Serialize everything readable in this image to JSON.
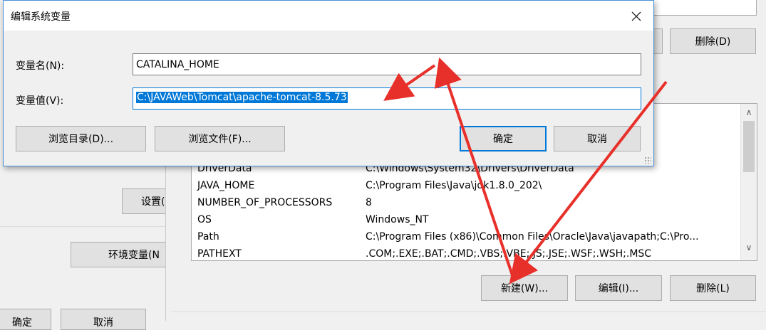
{
  "background_window": {
    "buttons": {
      "settings_partial": "设置(",
      "env_vars_partial": "环境变量(N",
      "ok_partial": "确定",
      "cancel_partial": "取消"
    }
  },
  "env_window": {
    "user_delete_button": "删除(D)",
    "system_vars": {
      "rows": [
        {
          "name": "DriverData",
          "value": "C:\\Windows\\System32\\Drivers\\DriverData"
        },
        {
          "name": "JAVA_HOME",
          "value": "C:\\Program Files\\Java\\jdk1.8.0_202\\"
        },
        {
          "name": "NUMBER_OF_PROCESSORS",
          "value": "8"
        },
        {
          "name": "OS",
          "value": "Windows_NT"
        },
        {
          "name": "Path",
          "value": "C:\\Program Files (x86)\\Common Files\\Oracle\\Java\\javapath;C:\\Pro..."
        },
        {
          "name": "PATHEXT",
          "value": ".COM;.EXE;.BAT;.CMD;.VBS;.VBE;.JS;.JSE;.WSF;.WSH;.MSC"
        }
      ]
    },
    "buttons": {
      "new": "新建(W)...",
      "edit": "编辑(I)...",
      "delete": "删除(L)"
    }
  },
  "dialog": {
    "title": "编辑系统变量",
    "name_label": "变量名(N):",
    "name_value": "CATALINA_HOME",
    "value_label": "变量值(V):",
    "value_value": "C:\\JAVAWeb\\Tomcat\\apache-tomcat-8.5.73",
    "browse_dir": "浏览目录(D)...",
    "browse_file": "浏览文件(F)...",
    "ok": "确定",
    "cancel": "取消"
  },
  "colors": {
    "selection": "#0078d7",
    "annotation_arrow": "#e8302a",
    "dialog_border": "#4a90d9"
  }
}
